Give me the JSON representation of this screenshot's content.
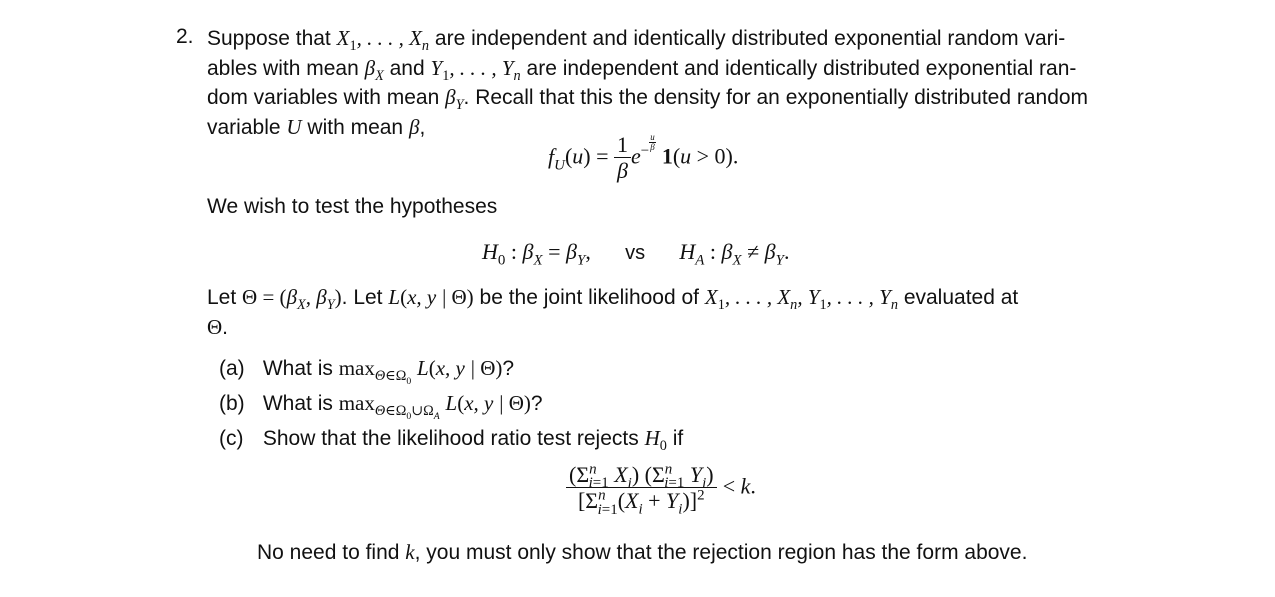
{
  "problem": {
    "number": "2.",
    "intro_lines": [
      "Suppose that X₁, …, Xₙ are independent and identically distributed exponential random vari-",
      "ables with mean β_X and Y₁, …, Yₙ are independent and identically distributed exponential ran-",
      "dom variables with mean β_Y. Recall that this the density for an exponentially distributed random",
      "variable U with mean β,"
    ],
    "t": {
      "suppose": "Suppose that",
      "are_iid_1": "are independent and identically distributed exponential random vari-",
      "ables_mean": "ables with mean",
      "and": "and",
      "are_iid_2": "are independent and identically distributed exponential ran-",
      "dom_vars": "dom variables with mean",
      "recall": ". Recall that this the density for an exponentially distributed random",
      "variable": "variable",
      "with_mean": "with mean",
      "comma": ","
    },
    "density_formula": "f_U(u) = (1/β) e^{-u/β} 1(u > 0).",
    "hypotheses_intro": "We wish to test the hypotheses",
    "hypotheses": {
      "null": "H₀ : β_X = β_Y,",
      "vs": "vs",
      "alt": "H_A : β_X ≠ β_Y."
    },
    "let_text": {
      "let1": "Let",
      "let2": ". Let",
      "joint": "be the joint likelihood of",
      "evaluated": "evaluated at",
      "end": "."
    },
    "parts": [
      {
        "label": "(a)",
        "text": "What is",
        "math": "max_{Θ∈Ω₀} L(x, y | Θ)",
        "end": "?"
      },
      {
        "label": "(b)",
        "text": "What is",
        "math": "max_{Θ∈Ω₀∪Ω_A} L(x, y | Θ)",
        "end": "?"
      },
      {
        "label": "(c)",
        "text": "Show that the likelihood ratio test rejects",
        "math": "H₀",
        "end": "if"
      }
    ],
    "rejection_formula": "(Σ_{i=1}^n X_i)(Σ_{i=1}^n Y_i) / [Σ_{i=1}^n (X_i + Y_i)]² < k.",
    "note": {
      "before": "No need to find",
      "var": "k",
      "after": ", you must only show that the rejection region has the form above."
    }
  }
}
